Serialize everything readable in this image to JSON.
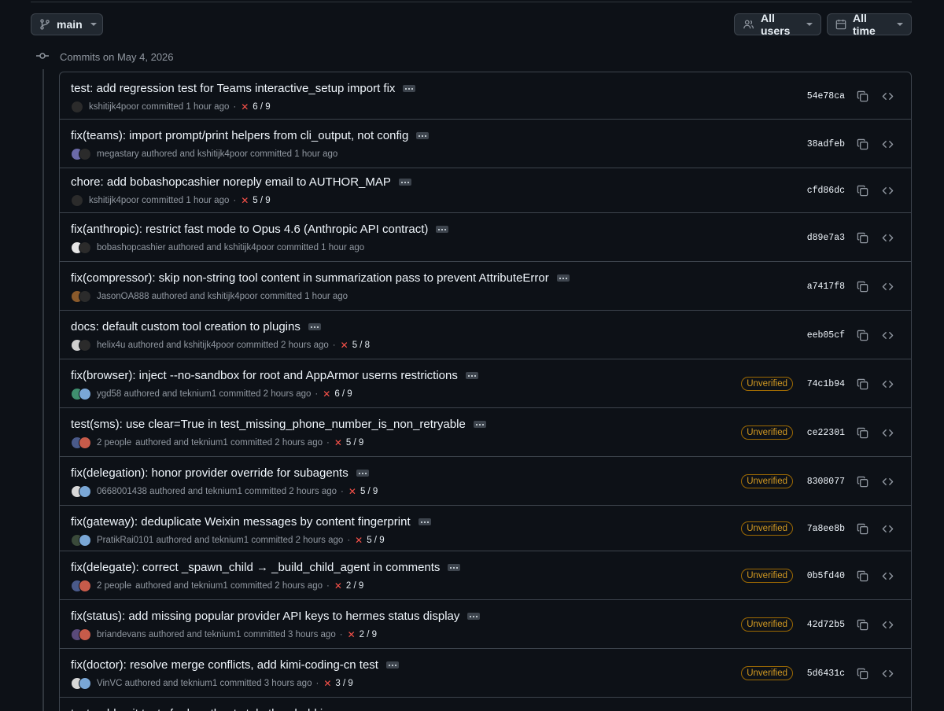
{
  "toolbar": {
    "branch": "main",
    "users_label": "All users",
    "time_label": "All time"
  },
  "group": {
    "title": "Commits on May 4, 2026"
  },
  "commits": [
    {
      "message": "test: add regression test for Teams interactive_setup import fix",
      "people": "",
      "users": [
        "kshitijk4poor"
      ],
      "verb": "committed",
      "time": "1 hour ago",
      "checks": "6 / 9",
      "unverified": "",
      "sha": "54e78ca",
      "avatar_colors": [
        "#2b2b2b"
      ]
    },
    {
      "message": "fix(teams): import prompt/print helpers from cli_output, not config",
      "people": "",
      "users": [
        "megastary",
        "kshitijk4poor"
      ],
      "verb": "authored and",
      "verb2": "committed",
      "time": "1 hour ago",
      "checks": "",
      "unverified": "",
      "sha": "38adfeb",
      "avatar_colors": [
        "#6b6aa8",
        "#2b2b2b"
      ]
    },
    {
      "message": "chore: add bobashopcashier noreply email to AUTHOR_MAP",
      "people": "",
      "users": [
        "kshitijk4poor"
      ],
      "verb": "committed",
      "time": "1 hour ago",
      "checks": "5 / 9",
      "unverified": "",
      "sha": "cfd86dc",
      "avatar_colors": [
        "#2b2b2b"
      ]
    },
    {
      "message": "fix(anthropic): restrict fast mode to Opus 4.6 (Anthropic API contract)",
      "people": "",
      "users": [
        "bobashopcashier",
        "kshitijk4poor"
      ],
      "verb": "authored and",
      "verb2": "committed",
      "time": "1 hour ago",
      "checks": "",
      "unverified": "",
      "sha": "d89e7a3",
      "avatar_colors": [
        "#e6e6e6",
        "#2b2b2b"
      ]
    },
    {
      "message": "fix(compressor): skip non-string tool content in summarization pass to prevent AttributeError",
      "people": "",
      "users": [
        "JasonOA888",
        "kshitijk4poor"
      ],
      "verb": "authored and",
      "verb2": "committed",
      "time": "1 hour ago",
      "checks": "",
      "unverified": "",
      "sha": "a7417f8",
      "avatar_colors": [
        "#8a5a2b",
        "#2b2b2b"
      ]
    },
    {
      "message": "docs: default custom tool creation to plugins",
      "people": "",
      "users": [
        "helix4u",
        "kshitijk4poor"
      ],
      "verb": "authored and",
      "verb2": "committed",
      "time": "2 hours ago",
      "checks": "5 / 8",
      "unverified": "",
      "sha": "eeb05cf",
      "avatar_colors": [
        "#cfcfcf",
        "#2b2b2b"
      ]
    },
    {
      "message": "fix(browser): inject --no-sandbox for root and AppArmor userns restrictions",
      "people": "",
      "users": [
        "ygd58",
        "teknium1"
      ],
      "verb": "authored and",
      "verb2": "committed",
      "time": "2 hours ago",
      "checks": "6 / 9",
      "unverified": "Unverified",
      "sha": "74c1b94",
      "avatar_colors": [
        "#3f8f6f",
        "#7aa7d6"
      ]
    },
    {
      "message": "test(sms): use clear=True in test_missing_phone_number_is_non_retryable",
      "people": "2 people",
      "users": [
        "teknium1"
      ],
      "verb": "authored and",
      "verb2": "committed",
      "time": "2 hours ago",
      "checks": "5 / 9",
      "unverified": "Unverified",
      "sha": "ce22301",
      "avatar_colors": [
        "#4a5a8a",
        "#c75b4a"
      ]
    },
    {
      "message": "fix(delegation): honor provider override for subagents",
      "people": "",
      "users": [
        "0668001438",
        "teknium1"
      ],
      "verb": "authored and",
      "verb2": "committed",
      "time": "2 hours ago",
      "checks": "5 / 9",
      "unverified": "Unverified",
      "sha": "8308077",
      "avatar_colors": [
        "#d8d8d8",
        "#7aa7d6"
      ]
    },
    {
      "message": "fix(gateway): deduplicate Weixin messages by content fingerprint",
      "people": "",
      "users": [
        "PratikRai0101",
        "teknium1"
      ],
      "verb": "authored and",
      "verb2": "committed",
      "time": "2 hours ago",
      "checks": "5 / 9",
      "unverified": "Unverified",
      "sha": "7a8ee8b",
      "avatar_colors": [
        "#3a4a3a",
        "#7aa7d6"
      ]
    },
    {
      "message": "fix(delegate): correct _spawn_child → _build_child_agent in comments",
      "people": "2 people",
      "users": [
        "teknium1"
      ],
      "verb": "authored and",
      "verb2": "committed",
      "time": "2 hours ago",
      "checks": "2 / 9",
      "unverified": "Unverified",
      "sha": "0b5fd40",
      "avatar_colors": [
        "#4a5a8a",
        "#c75b4a"
      ]
    },
    {
      "message": "fix(status): add missing popular provider API keys to hermes status display",
      "people": "",
      "users": [
        "briandevans",
        "teknium1"
      ],
      "verb": "authored and",
      "verb2": "committed",
      "time": "3 hours ago",
      "checks": "2 / 9",
      "unverified": "Unverified",
      "sha": "42d72b5",
      "avatar_colors": [
        "#5a4a7a",
        "#c75b4a"
      ]
    },
    {
      "message": "fix(doctor): resolve merge conflicts, add kimi-coding-cn test",
      "people": "",
      "users": [
        "VinVC",
        "teknium1"
      ],
      "verb": "authored and",
      "verb2": "committed",
      "time": "3 hours ago",
      "checks": "3 / 9",
      "unverified": "Unverified",
      "sha": "5d6431c",
      "avatar_colors": [
        "#d8d8d8",
        "#7aa7d6"
      ]
    },
    {
      "message": "test: add unit tests for heartbeat stale threshold increase",
      "people": "",
      "users": [],
      "verb": "",
      "time": "",
      "checks": "",
      "unverified": "",
      "sha": "",
      "avatar_colors": []
    }
  ]
}
